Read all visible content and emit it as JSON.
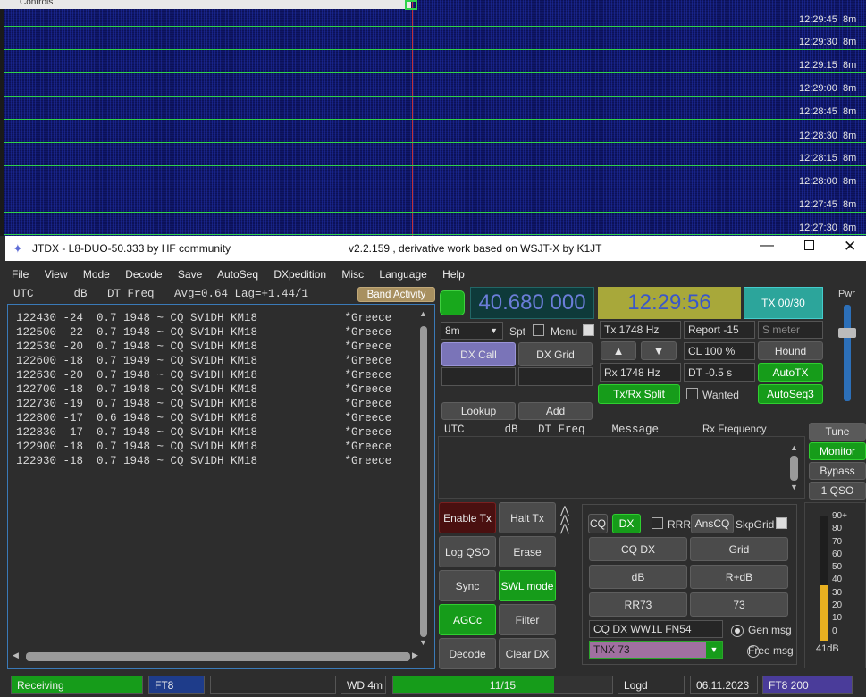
{
  "waterfall": {
    "controls_label": "Controls",
    "rows": [
      {
        "time": "12:29:45",
        "band": "8m"
      },
      {
        "time": "12:29:30",
        "band": "8m"
      },
      {
        "time": "12:29:15",
        "band": "8m"
      },
      {
        "time": "12:29:00",
        "band": "8m"
      },
      {
        "time": "12:28:45",
        "band": "8m"
      },
      {
        "time": "12:28:30",
        "band": "8m"
      },
      {
        "time": "12:28:15",
        "band": "8m"
      },
      {
        "time": "12:28:00",
        "band": "8m"
      },
      {
        "time": "12:27:45",
        "band": "8m"
      },
      {
        "time": "12:27:30",
        "band": "8m"
      }
    ]
  },
  "window": {
    "title_left": "JTDX - L8-DUO-50.333  by HF community",
    "title_right": "v2.2.159 , derivative work based on WSJT-X by K1JT"
  },
  "menu": [
    "File",
    "View",
    "Mode",
    "Decode",
    "Save",
    "AutoSeq",
    "DXpedition",
    "Misc",
    "Language",
    "Help"
  ],
  "decode_header": "UTC      dB   DT Freq   Avg=0.64 Lag=+1.44/1",
  "band_activity_label": "Band Activity",
  "decodes": [
    "122430 -24  0.7 1948 ~ CQ SV1DH KM18             *Greece",
    "122500 -22  0.7 1948 ~ CQ SV1DH KM18             *Greece",
    "122530 -20  0.7 1948 ~ CQ SV1DH KM18             *Greece",
    "122600 -18  0.7 1949 ~ CQ SV1DH KM18             *Greece",
    "122630 -20  0.7 1948 ~ CQ SV1DH KM18             *Greece",
    "122700 -18  0.7 1948 ~ CQ SV1DH KM18             *Greece",
    "122730 -19  0.7 1948 ~ CQ SV1DH KM18             *Greece",
    "122800 -17  0.6 1948 ~ CQ SV1DH KM18             *Greece",
    "122830 -17  0.7 1948 ~ CQ SV1DH KM18             *Greece",
    "122900 -18  0.7 1948 ~ CQ SV1DH KM18             *Greece",
    "122930 -18  0.7 1948 ~ CQ SV1DH KM18             *Greece"
  ],
  "freq_display": "40.680 000",
  "clock": "12:29:56",
  "tx_counter": "TX 00/30",
  "pwr_label": "Pwr",
  "band_select": "8m",
  "spt_label": "Spt",
  "menu_label": "Menu",
  "tx_freq": "Tx  1748  Hz",
  "report": "Report -15",
  "s_meter_placeholder": "S meter",
  "cl": "CL  100 %",
  "hound_label": "Hound",
  "rx_freq": "Rx  1748  Hz",
  "dt": "DT -0.5 s",
  "autotx_label": "AutoTX",
  "dxcall_label": "DX Call",
  "dxgrid_label": "DX Grid",
  "txrx_split_label": "Tx/Rx Split",
  "wanted_label": "Wanted",
  "autoseq3_label": "AutoSeq3",
  "lookup_label": "Lookup",
  "add_label": "Add",
  "rx_header": "UTC      dB   DT Freq    Message",
  "rx_frequency_label": "Rx Frequency",
  "right_buttons": {
    "tune": "Tune",
    "monitor": "Monitor",
    "bypass": "Bypass",
    "one_qso": "1 QSO"
  },
  "action_buttons": {
    "enable_tx": "Enable Tx",
    "halt_tx": "Halt Tx",
    "log_qso": "Log QSO",
    "erase": "Erase",
    "sync": "Sync",
    "swl_mode": "SWL mode",
    "agcc": "AGCc",
    "filter": "Filter",
    "decode": "Decode",
    "clear_dx": "Clear DX"
  },
  "tx_panel": {
    "cq": "CQ",
    "dx": "DX",
    "rrr": "RRR",
    "anscq": "AnsCQ",
    "skpgrid": "SkpGrid",
    "cq_dx": "CQ DX",
    "grid": "Grid",
    "db": "dB",
    "r_db": "R+dB",
    "rr73": "RR73",
    "s73": "73",
    "gen_msg_value": "CQ DX WW1L FN54",
    "gen_msg_label": "Gen msg",
    "free_msg_value": "TNX 73",
    "free_msg_label": "Free msg"
  },
  "meter": {
    "scale": [
      "90+",
      "80",
      "70",
      "60",
      "50",
      "40",
      "30",
      "20",
      "10",
      "0"
    ],
    "level_db": 40,
    "readout": "41dB"
  },
  "status_bar": {
    "state": "Receiving",
    "mode": "FT8",
    "blank": "",
    "wd": "WD 4m",
    "progress_text": "11/15",
    "progress_fraction": 0.733,
    "logd": "Logd",
    "date": "06.11.2023",
    "mode_rate": "FT8  200"
  },
  "colors": {
    "accent_green": "#169c1a",
    "freq_bg": "#0e3a3a",
    "clock_bg": "#a8a83a",
    "tx_bg": "#2ca59b"
  }
}
